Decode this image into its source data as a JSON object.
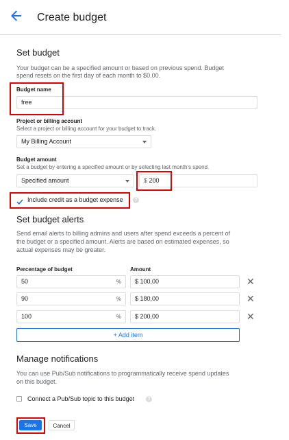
{
  "header": {
    "title": "Create budget"
  },
  "set_budget": {
    "heading": "Set budget",
    "description_line1": "Your budget can be a specified amount or based on previous spend. Budget",
    "description_line2": "spend resets on the first day of each month to $0.00.",
    "budget_name": {
      "label": "Budget name",
      "value": "free"
    },
    "project": {
      "label": "Project or billing account",
      "hint": "Select a project or billing account for your budget to track.",
      "value": "My Billing Account"
    },
    "amount": {
      "label": "Budget amount",
      "hint": "Set a budget by entering a specified amount or by selecting last month's spend.",
      "type_value": "Specified amount",
      "currency": "$",
      "value": "200"
    },
    "include_credit": {
      "label": "Include credit as a budget expense",
      "checked": true
    }
  },
  "alerts": {
    "heading": "Set budget alerts",
    "description_line1": "Send email alerts to billing admins and users after spend exceeds a percent of",
    "description_line2": "the budget or a specified amount. Alerts are based on estimated expenses, so",
    "description_line3": "actual expenses may be greater.",
    "col_percent": "Percentage of budget",
    "col_amount": "Amount",
    "percent_symbol": "%",
    "rows": [
      {
        "percent": "50",
        "amount": "$ 100,00"
      },
      {
        "percent": "90",
        "amount": "$ 180,00"
      },
      {
        "percent": "100",
        "amount": "$ 200,00"
      }
    ],
    "add_item": "+ Add item"
  },
  "notifications": {
    "heading": "Manage notifications",
    "description_line1": "You can use Pub/Sub notifications to programmatically receive spend updates",
    "description_line2": "on this budget.",
    "pubsub_label": "Connect a Pub/Sub topic to this budget"
  },
  "footer": {
    "save": "Save",
    "cancel": "Cancel"
  },
  "colors": {
    "accent": "#1a73e8",
    "highlight": "#e00000"
  },
  "icons": {
    "back": "arrow-left-icon",
    "remove": "close-icon",
    "help": "help-icon",
    "check": "check-icon",
    "dropdown": "chevron-down-icon"
  }
}
